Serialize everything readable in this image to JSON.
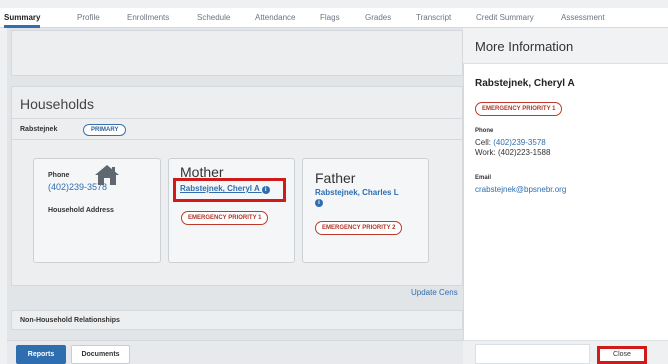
{
  "tabs": [
    {
      "label": "Summary"
    },
    {
      "label": "Profile"
    },
    {
      "label": "Enrollments"
    },
    {
      "label": "Schedule"
    },
    {
      "label": "Attendance"
    },
    {
      "label": "Flags"
    },
    {
      "label": "Grades"
    },
    {
      "label": "Transcript"
    },
    {
      "label": "Credit Summary"
    },
    {
      "label": "Assessment"
    }
  ],
  "households": {
    "title": "Households",
    "name": "Rabstejnek",
    "primary_badge": "PRIMARY",
    "phone_label": "Phone",
    "phone": "(402)239-3578",
    "address_label": "Household Address",
    "mother": {
      "role": "Mother",
      "name": "Rabstejnek, Cheryl A",
      "badge": "EMERGENCY PRIORITY 1"
    },
    "father": {
      "role": "Father",
      "name": "Rabstejnek, Charles L",
      "badge": "EMERGENCY PRIORITY 2"
    },
    "update_link": "Update Cens"
  },
  "non_household": {
    "label": "Non-Household Relationships"
  },
  "footer": {
    "reports": "Reports",
    "documents": "Documents"
  },
  "panel": {
    "title": "More Information",
    "name": "Rabstejnek, Cheryl A",
    "badge": "EMERGENCY PRIORITY 1",
    "phone_label": "Phone",
    "cell_prefix": "Cell: ",
    "cell": "(402)239-3578",
    "work": "Work: (402)223-1588",
    "email_label": "Email",
    "email": "crabstejnek@bpsnebr.org",
    "close": "Close"
  },
  "colors": {
    "accent": "#2e6db0",
    "alert": "#c0392b",
    "highlight": "#d11b1b"
  },
  "icons": {
    "home": "house-icon",
    "info": "info-icon"
  }
}
